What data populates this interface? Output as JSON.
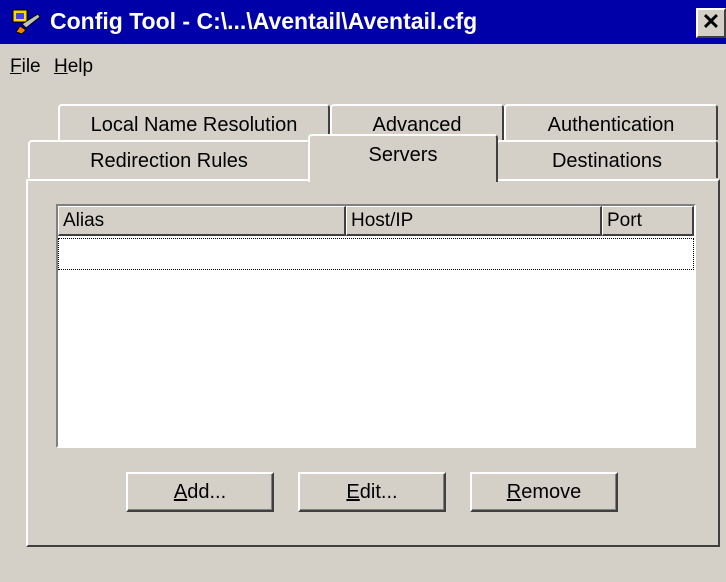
{
  "window": {
    "title": "Config Tool - C:\\...\\Aventail\\Aventail.cfg",
    "close_label": "✕"
  },
  "menu": [
    {
      "mnemonic": "F",
      "rest": "ile"
    },
    {
      "mnemonic": "H",
      "rest": "elp"
    }
  ],
  "tabs": {
    "back_row": [
      "Local Name Resolution",
      "Advanced",
      "Authentication"
    ],
    "front_row": [
      "Redirection Rules",
      "Servers",
      "Destinations"
    ],
    "active": "Servers"
  },
  "servers_list": {
    "columns": [
      "Alias",
      "Host/IP",
      "Port"
    ],
    "rows": []
  },
  "buttons": {
    "add": {
      "mnemonic": "A",
      "rest": "dd..."
    },
    "edit": {
      "mnemonic": "E",
      "rest": "dit..."
    },
    "remove": {
      "mnemonic": "R",
      "rest": "emove"
    }
  },
  "colors": {
    "titlebar": "#0000a8",
    "face": "#d4d0c8"
  }
}
